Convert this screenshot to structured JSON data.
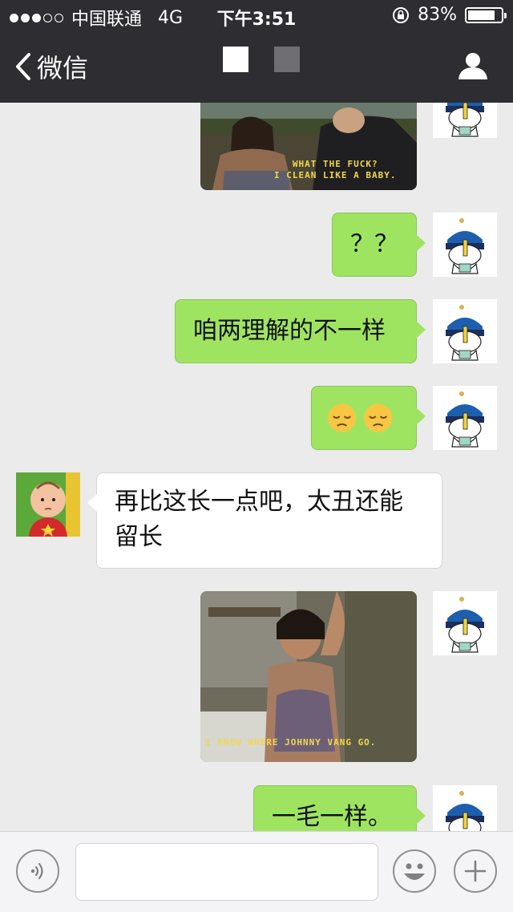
{
  "status": {
    "carrier": "中国联通",
    "network": "4G",
    "time": "下午3:51",
    "battery": "83%",
    "battery_level": 0.83
  },
  "nav": {
    "back_label": "微信"
  },
  "messages": [
    {
      "from": "me",
      "type": "image",
      "caption": "WHAT THE FUCK?\nI CLEAN LIKE A BABY."
    },
    {
      "from": "me",
      "type": "text",
      "text": "？？"
    },
    {
      "from": "me",
      "type": "text",
      "text": "咱两理解的不一样"
    },
    {
      "from": "me",
      "type": "emoji",
      "text": "😔😔"
    },
    {
      "from": "other",
      "type": "text",
      "text": "再比这长一点吧，太丑还能留长"
    },
    {
      "from": "me",
      "type": "image",
      "caption": "I KNOW WHERE JOHNNY VANG GO."
    },
    {
      "from": "me",
      "type": "text",
      "text": "一毛一样。"
    }
  ],
  "input": {
    "placeholder": ""
  },
  "colors": {
    "topbar": "#2d2d32",
    "my_bubble": "#9fe461",
    "chat_bg": "#ebebeb"
  }
}
